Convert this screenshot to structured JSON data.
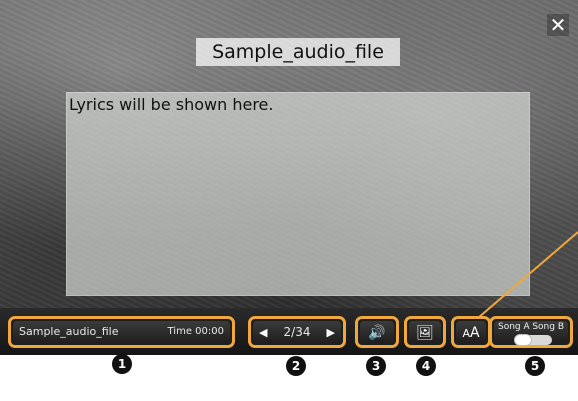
{
  "window": {
    "title": "Sample_audio_file",
    "close_icon": "close-icon"
  },
  "lyrics": {
    "placeholder_text": "Lyrics will be shown here."
  },
  "controls": {
    "song_name": "Sample_audio_file",
    "time_label": "Time",
    "time_value": "00:00",
    "page_counter": "2/34",
    "prev_icon": "chevron-left-icon",
    "next_icon": "chevron-right-icon",
    "volume_icon": "speaker-icon",
    "background_icon": "image-icon",
    "font_size_icon": "aA-icon",
    "song_a": "Song A",
    "song_b": "Song B"
  },
  "callouts": [
    "1",
    "2",
    "3",
    "4",
    "5"
  ],
  "colors": {
    "highlight": "#f0a73c"
  }
}
